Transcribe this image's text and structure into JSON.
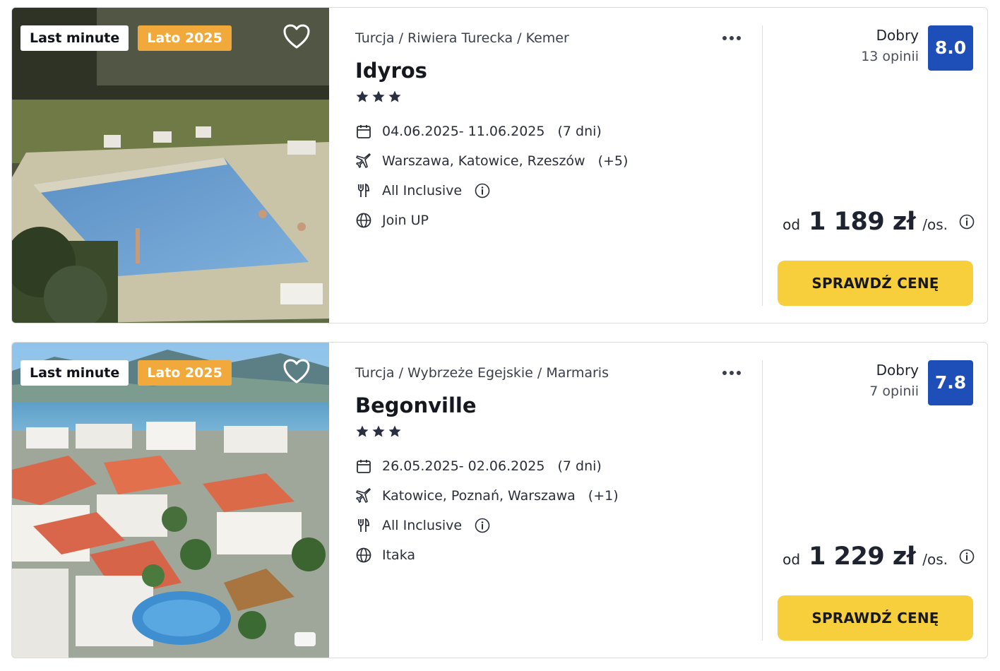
{
  "offers": [
    {
      "badges": {
        "last_minute": "Last minute",
        "season": "Lato 2025"
      },
      "breadcrumb": "Turcja / Riwiera Turecka / Kemer",
      "name": "Idyros",
      "stars": 3,
      "dates": "04.06.2025- 11.06.2025",
      "duration": "(7 dni)",
      "departures": "Warszawa, Katowice, Rzeszów",
      "departures_more": "(+5)",
      "board": "All Inclusive",
      "operator": "Join UP",
      "rating_label": "Dobry",
      "reviews": "13 opinii",
      "score": "8.0",
      "price_from": "od",
      "price": "1 189 zł",
      "per_person": "/os.",
      "cta": "SPRAWDŹ CENĘ",
      "photo": "hotel-pool-photo"
    },
    {
      "badges": {
        "last_minute": "Last minute",
        "season": "Lato 2025"
      },
      "breadcrumb": "Turcja / Wybrzeże Egejskie / Marmaris",
      "name": "Begonville",
      "stars": 3,
      "dates": "26.05.2025- 02.06.2025",
      "duration": "(7 dni)",
      "departures": "Katowice, Poznań, Warszawa",
      "departures_more": "(+1)",
      "board": "All Inclusive",
      "operator": "Itaka",
      "rating_label": "Dobry",
      "reviews": "7 opinii",
      "score": "7.8",
      "price_from": "od",
      "price": "1 229 zł",
      "per_person": "/os.",
      "cta": "SPRAWDŹ CENĘ",
      "photo": "coastal-town-aerial-photo"
    }
  ],
  "colors": {
    "score_bg": "#1e4eb8",
    "cta_bg": "#f7cf3d",
    "season_badge": "#f2a93b"
  }
}
